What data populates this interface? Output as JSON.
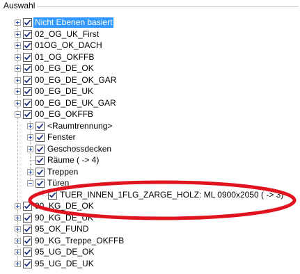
{
  "group": {
    "title": "Auswahl"
  },
  "tree": {
    "items": [
      {
        "label": "Nicht Ebenen basiert",
        "level": 0,
        "checked": true,
        "expander": "plus",
        "selected": true
      },
      {
        "label": "02_OG_UK_First",
        "level": 0,
        "checked": true,
        "expander": "plus"
      },
      {
        "label": "01OG_OK_DACH",
        "level": 0,
        "checked": true,
        "expander": "plus"
      },
      {
        "label": "01_OG_OKFFB",
        "level": 0,
        "checked": true,
        "expander": "plus"
      },
      {
        "label": "00_EG_DE_OK",
        "level": 0,
        "checked": true,
        "expander": "plus"
      },
      {
        "label": "00_EG_DE_OK_GAR",
        "level": 0,
        "checked": true,
        "expander": "plus"
      },
      {
        "label": "00_EG_DE_UK",
        "level": 0,
        "checked": true,
        "expander": "plus"
      },
      {
        "label": "00_EG_DE_UK_GAR",
        "level": 0,
        "checked": true,
        "expander": "plus"
      },
      {
        "label": "00_EG_OKFFB",
        "level": 0,
        "checked": true,
        "expander": "minus"
      },
      {
        "label": "<Raumtrennung>",
        "level": 1,
        "checked": true,
        "expander": "plus"
      },
      {
        "label": "Fenster",
        "level": 1,
        "checked": true,
        "expander": "plus"
      },
      {
        "label": "Geschossdecken",
        "level": 1,
        "checked": true,
        "expander": "plus"
      },
      {
        "label": "Räume ( -> 4)",
        "level": 1,
        "checked": true,
        "expander": "none"
      },
      {
        "label": "Treppen",
        "level": 1,
        "checked": true,
        "expander": "plus"
      },
      {
        "label": "Türen",
        "level": 1,
        "checked": true,
        "expander": "minus"
      },
      {
        "label": "TUER_INNEN_1FLG_ZARGE_HOLZ: ML 0900x2050 ( -> 3)",
        "level": 2,
        "checked": true,
        "expander": "none"
      },
      {
        "label": "90_KG_DE_OK",
        "level": 0,
        "checked": true,
        "expander": "plus"
      },
      {
        "label": "90_KG_DE_UK",
        "level": 0,
        "checked": true,
        "expander": "plus"
      },
      {
        "label": "95_OK_FUND",
        "level": 0,
        "checked": true,
        "expander": "plus"
      },
      {
        "label": "90_KG_Treppe_OKFFB",
        "level": 0,
        "checked": true,
        "expander": "plus"
      },
      {
        "label": "95_UG_DE_OK",
        "level": 0,
        "checked": true,
        "expander": "plus"
      },
      {
        "label": "95_UG_DE_UK",
        "level": 0,
        "checked": true,
        "expander": "plus"
      }
    ]
  },
  "annotation": {
    "color": "#e0141e"
  },
  "colors": {
    "selection": "#3399ff",
    "check": "#1f2f7a"
  }
}
